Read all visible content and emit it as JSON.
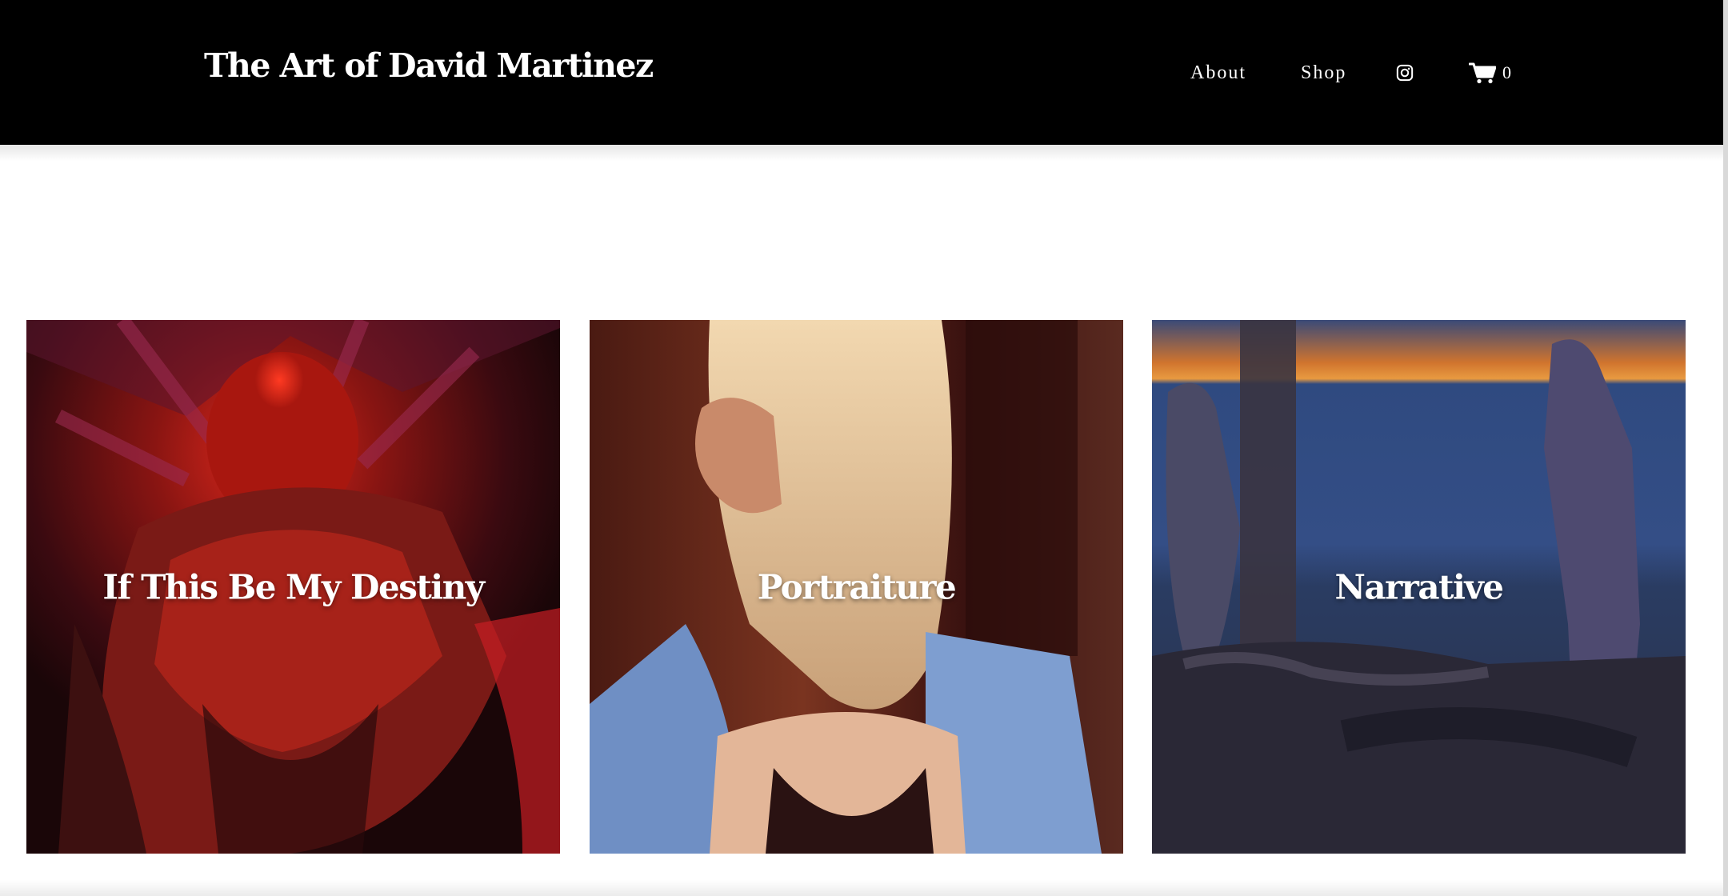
{
  "header": {
    "site_title": "The Art of David Martinez",
    "nav": {
      "about": "About",
      "shop": "Shop",
      "instagram_icon": "instagram-icon",
      "cart_icon": "cart-icon",
      "cart_count": "0"
    }
  },
  "gallery": {
    "items": [
      {
        "title": "If This Be My Destiny"
      },
      {
        "title": "Portraiture"
      },
      {
        "title": "Narrative"
      }
    ]
  },
  "colors": {
    "header_bg": "#000000",
    "page_bg": "#ffffff",
    "text_on_dark": "#ffffff"
  }
}
